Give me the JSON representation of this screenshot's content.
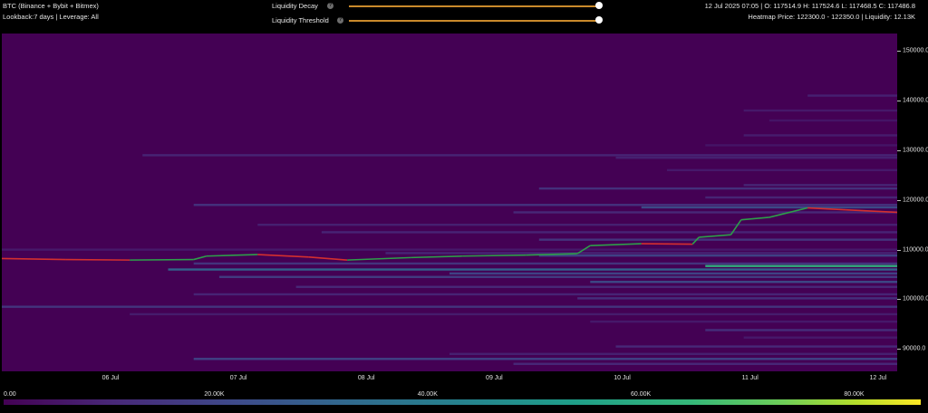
{
  "header": {
    "title": "BTC (Binance + Bybit + Bitmex)",
    "subtitle": "Lookback:7 days | Leverage: All",
    "ohlc": "12 Jul 2025 07:05 | O: 117514.9 H: 117524.6 L: 117468.5 C: 117486.8",
    "heatmap_info": "Heatmap Price: 122300.0 - 122350.0 | Liquidity: 12.13K",
    "help_glyph": "?"
  },
  "controls": {
    "liquidity_decay": {
      "label": "Liquidity Decay",
      "value": 1.0
    },
    "liquidity_threshold": {
      "label": "Liquidity Threshold",
      "value": 1.0
    }
  },
  "colors": {
    "slider_track": "#c98a2b",
    "background": "#440154",
    "candle_up": "#2e9e4a",
    "candle_down": "#d32f2f"
  },
  "chart_data": {
    "type": "heatmap",
    "y_ticks": [
      "90000.0",
      "100000.0",
      "110000.0",
      "120000.0",
      "130000.0",
      "140000.0",
      "150000.0"
    ],
    "y_tick_values": [
      90000,
      100000,
      110000,
      120000,
      130000,
      140000,
      150000
    ],
    "ylim": [
      85500,
      153500
    ],
    "x_ticks": [
      "06 Jul",
      "07 Jul",
      "08 Jul",
      "09 Jul",
      "10 Jul",
      "11 Jul",
      "12 Jul"
    ],
    "x_tick_values": [
      0.85,
      1.85,
      2.85,
      3.85,
      4.85,
      5.85,
      6.85
    ],
    "xlim": [
      0,
      7
    ],
    "colorbar": {
      "labels": [
        "0.00",
        "20.00K",
        "40.00K",
        "60.00K",
        "80.00K"
      ],
      "max": 86000
    },
    "price_path": [
      [
        0.0,
        108200
      ],
      [
        0.5,
        108000
      ],
      [
        1.0,
        107900
      ],
      [
        1.5,
        108000
      ],
      [
        1.6,
        108700
      ],
      [
        2.0,
        109000
      ],
      [
        2.4,
        108500
      ],
      [
        2.7,
        107900
      ],
      [
        3.2,
        108400
      ],
      [
        3.6,
        108700
      ],
      [
        4.1,
        108900
      ],
      [
        4.5,
        109200
      ],
      [
        4.6,
        110800
      ],
      [
        5.0,
        111200
      ],
      [
        5.4,
        111100
      ],
      [
        5.45,
        112500
      ],
      [
        5.7,
        113000
      ],
      [
        5.78,
        116000
      ],
      [
        6.0,
        116500
      ],
      [
        6.3,
        118400
      ],
      [
        6.6,
        118000
      ],
      [
        7.0,
        117500
      ]
    ],
    "liquidity_bands": [
      {
        "price": 141000,
        "start": 6.3,
        "value": 8000
      },
      {
        "price": 138000,
        "start": 5.8,
        "value": 6000
      },
      {
        "price": 136000,
        "start": 6.0,
        "value": 5000
      },
      {
        "price": 133000,
        "start": 5.8,
        "value": 7000
      },
      {
        "price": 131000,
        "start": 5.5,
        "value": 5000
      },
      {
        "price": 129000,
        "start": 1.1,
        "value": 9000
      },
      {
        "price": 128500,
        "start": 4.8,
        "value": 8000
      },
      {
        "price": 126000,
        "start": 5.2,
        "value": 6000
      },
      {
        "price": 123000,
        "start": 5.8,
        "value": 9000
      },
      {
        "price": 122300,
        "start": 4.2,
        "value": 12130
      },
      {
        "price": 120500,
        "start": 5.5,
        "value": 9000
      },
      {
        "price": 119000,
        "start": 1.5,
        "value": 13000
      },
      {
        "price": 118500,
        "start": 5.0,
        "value": 20000
      },
      {
        "price": 117500,
        "start": 4.0,
        "value": 10000
      },
      {
        "price": 115000,
        "start": 2.0,
        "value": 8000
      },
      {
        "price": 113500,
        "start": 2.5,
        "value": 9000
      },
      {
        "price": 112000,
        "start": 4.2,
        "value": 14000
      },
      {
        "price": 110000,
        "start": 0.0,
        "value": 6000
      },
      {
        "price": 109300,
        "start": 3.0,
        "value": 9000
      },
      {
        "price": 108800,
        "start": 4.2,
        "value": 18000
      },
      {
        "price": 107200,
        "start": 1.5,
        "value": 14000
      },
      {
        "price": 106700,
        "start": 5.5,
        "value": 55000
      },
      {
        "price": 106000,
        "start": 1.3,
        "value": 28000
      },
      {
        "price": 105200,
        "start": 3.5,
        "value": 18000
      },
      {
        "price": 104500,
        "start": 1.7,
        "value": 16000
      },
      {
        "price": 103500,
        "start": 4.6,
        "value": 20000
      },
      {
        "price": 102500,
        "start": 2.3,
        "value": 10000
      },
      {
        "price": 101000,
        "start": 1.5,
        "value": 9000
      },
      {
        "price": 100200,
        "start": 4.5,
        "value": 12000
      },
      {
        "price": 98500,
        "start": 0.0,
        "value": 14000
      },
      {
        "price": 97000,
        "start": 1.0,
        "value": 7000
      },
      {
        "price": 95500,
        "start": 4.6,
        "value": 6000
      },
      {
        "price": 93800,
        "start": 5.5,
        "value": 12000
      },
      {
        "price": 92300,
        "start": 5.8,
        "value": 6000
      },
      {
        "price": 90500,
        "start": 4.8,
        "value": 10000
      },
      {
        "price": 89000,
        "start": 3.5,
        "value": 8000
      },
      {
        "price": 88000,
        "start": 1.5,
        "value": 18000
      },
      {
        "price": 87000,
        "start": 4.0,
        "value": 10000
      }
    ]
  }
}
